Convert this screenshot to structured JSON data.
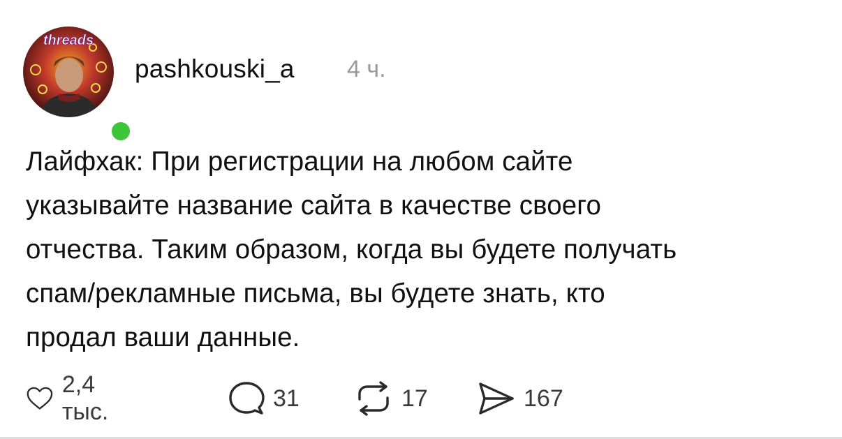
{
  "post": {
    "avatar": {
      "badge_text": "threads",
      "icon": "user-avatar",
      "status_color": "#3fc53a"
    },
    "username": "pashkouski_a",
    "timestamp": "4 ч.",
    "text_lines": [
      "Лайфхак: При регистрации на любом сайте",
      "указывайте название сайта в качестве своего",
      "отчества. Таким образом, когда вы будете получать",
      "спам/рекламные письма, вы будете знать, кто",
      "продал ваши данные."
    ],
    "actions": {
      "like": {
        "icon": "heart-icon",
        "count": "2,4 тыс."
      },
      "comment": {
        "icon": "comment-icon",
        "count": "31"
      },
      "repost": {
        "icon": "repost-icon",
        "count": "17"
      },
      "share": {
        "icon": "share-icon",
        "count": "167"
      }
    }
  }
}
